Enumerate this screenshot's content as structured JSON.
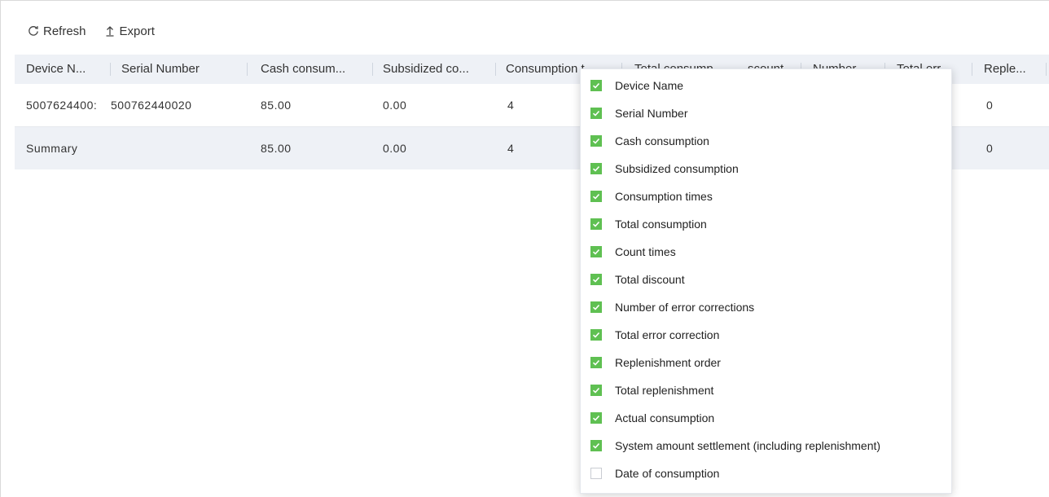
{
  "toolbar": {
    "refresh_label": "Refresh",
    "export_label": "Export"
  },
  "table": {
    "columns": [
      "Device N...",
      "Serial Number",
      "Cash consum...",
      "Subsidized co...",
      "Consumption t",
      "Total consump",
      "scount",
      "Number",
      "Total err...",
      "Reple..."
    ],
    "rows": [
      [
        "5007624400:",
        "500762440020",
        "85.00",
        "0.00",
        "4",
        "0"
      ]
    ],
    "summary": [
      "Summary",
      "85.00",
      "0.00",
      "4",
      "0"
    ]
  },
  "column_menu": {
    "options": [
      {
        "label": "Device Name",
        "checked": true
      },
      {
        "label": "Serial Number",
        "checked": true
      },
      {
        "label": "Cash consumption",
        "checked": true
      },
      {
        "label": "Subsidized consumption",
        "checked": true
      },
      {
        "label": "Consumption times",
        "checked": true
      },
      {
        "label": "Total consumption",
        "checked": true
      },
      {
        "label": "Count times",
        "checked": true
      },
      {
        "label": "Total discount",
        "checked": true
      },
      {
        "label": "Number of error corrections",
        "checked": true
      },
      {
        "label": "Total error correction",
        "checked": true
      },
      {
        "label": "Replenishment order",
        "checked": true
      },
      {
        "label": "Total replenishment",
        "checked": true
      },
      {
        "label": "Actual consumption",
        "checked": true
      },
      {
        "label": "System amount settlement (including replenishment)",
        "checked": true
      },
      {
        "label": "Date of consumption",
        "checked": false
      }
    ]
  },
  "colors": {
    "checkbox_checked": "#5fc052",
    "header_bg": "#eef1f6",
    "summary_bg": "#eef1f6"
  }
}
